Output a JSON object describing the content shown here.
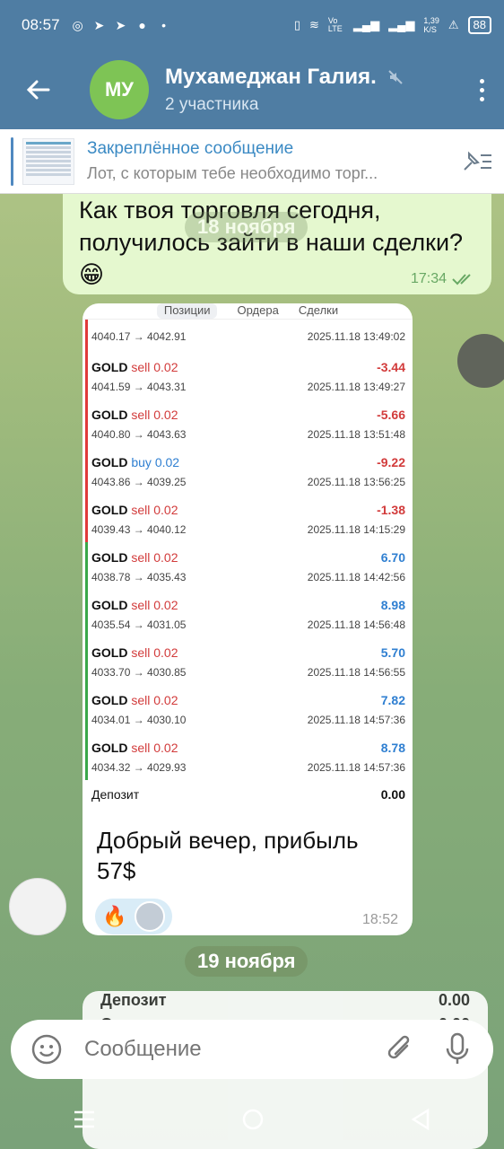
{
  "status_bar": {
    "time": "08:57",
    "network_speed": "1,39",
    "network_unit": "K/S",
    "battery": "88",
    "volte": "Vo LTE"
  },
  "header": {
    "avatar_initials": "МУ",
    "title": "Мухамеджан Галия.",
    "subtitle": "2 участника"
  },
  "pinned": {
    "title": "Закреплённое сообщение",
    "preview": "Лот, с которым тебе необходимо торг..."
  },
  "messages": {
    "outgoing": {
      "text": "Как твоя торговля сегодня, получилось зайти в наши сделки? 😁",
      "time": "17:34"
    },
    "date_overlay": "18 ноября",
    "incoming": {
      "tabs": [
        "Позиции",
        "Ордера",
        "Сделки"
      ],
      "first_row": {
        "prices": "4040.17 → 4042.91",
        "datetime": "2025.11.18 13:49:02"
      },
      "trades": [
        {
          "symbol": "GOLD",
          "side": "sell",
          "volume": "0.02",
          "pl": "-3.44",
          "prices": "4041.59 → 4043.31",
          "datetime": "2025.11.18 13:49:27",
          "kind": "loss"
        },
        {
          "symbol": "GOLD",
          "side": "sell",
          "volume": "0.02",
          "pl": "-5.66",
          "prices": "4040.80 → 4043.63",
          "datetime": "2025.11.18 13:51:48",
          "kind": "loss"
        },
        {
          "symbol": "GOLD",
          "side": "buy",
          "volume": "0.02",
          "pl": "-9.22",
          "prices": "4043.86 → 4039.25",
          "datetime": "2025.11.18 13:56:25",
          "kind": "loss"
        },
        {
          "symbol": "GOLD",
          "side": "sell",
          "volume": "0.02",
          "pl": "-1.38",
          "prices": "4039.43 → 4040.12",
          "datetime": "2025.11.18 14:15:29",
          "kind": "loss"
        },
        {
          "symbol": "GOLD",
          "side": "sell",
          "volume": "0.02",
          "pl": "6.70",
          "prices": "4038.78 → 4035.43",
          "datetime": "2025.11.18 14:42:56",
          "kind": "gain"
        },
        {
          "symbol": "GOLD",
          "side": "sell",
          "volume": "0.02",
          "pl": "8.98",
          "prices": "4035.54 → 4031.05",
          "datetime": "2025.11.18 14:56:48",
          "kind": "gain"
        },
        {
          "symbol": "GOLD",
          "side": "sell",
          "volume": "0.02",
          "pl": "5.70",
          "prices": "4033.70 → 4030.85",
          "datetime": "2025.11.18 14:56:55",
          "kind": "gain"
        },
        {
          "symbol": "GOLD",
          "side": "sell",
          "volume": "0.02",
          "pl": "7.82",
          "prices": "4034.01 → 4030.10",
          "datetime": "2025.11.18 14:57:36",
          "kind": "gain"
        },
        {
          "symbol": "GOLD",
          "side": "sell",
          "volume": "0.02",
          "pl": "8.78",
          "prices": "4034.32 → 4029.93",
          "datetime": "2025.11.18 14:57:36",
          "kind": "gain"
        }
      ],
      "deposit_label": "Депозит",
      "deposit_value": "0.00",
      "caption": "Добрый вечер, прибыль 57$",
      "reaction_emoji": "🔥",
      "time": "18:52"
    },
    "date_pill": "19 ноября",
    "partial": {
      "row1_label": "Депозит",
      "row1_value": "0.00",
      "row2_label": "Своп:",
      "row2_value": "0.00"
    }
  },
  "composer": {
    "placeholder": "Сообщение"
  }
}
